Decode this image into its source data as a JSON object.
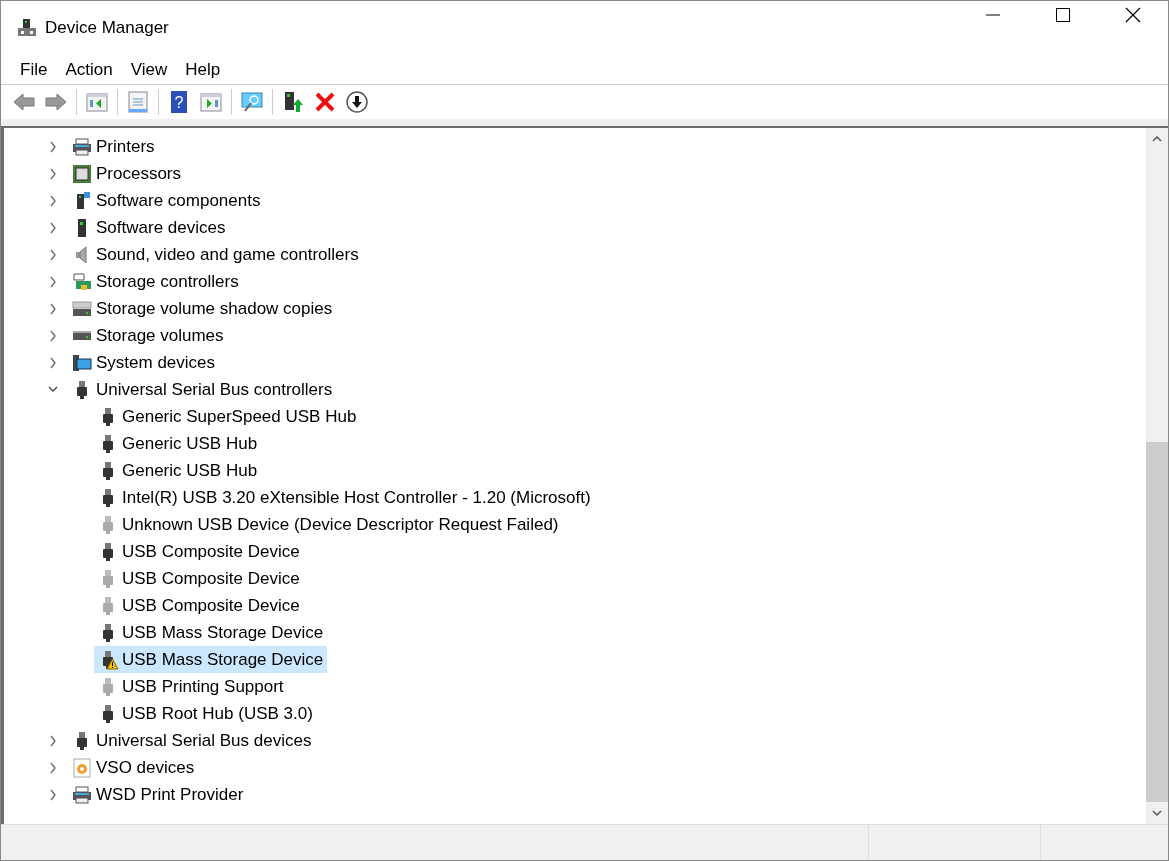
{
  "window": {
    "title": "Device Manager"
  },
  "menu": [
    "File",
    "Action",
    "View",
    "Help"
  ],
  "toolbar": {
    "help_glyph": "?"
  },
  "tree": [
    {
      "label": "Printers",
      "kind": "printer",
      "expanded": false,
      "selected": false
    },
    {
      "label": "Processors",
      "kind": "chip",
      "expanded": false,
      "selected": false
    },
    {
      "label": "Software components",
      "kind": "component",
      "expanded": false,
      "selected": false
    },
    {
      "label": "Software devices",
      "kind": "tower",
      "expanded": false,
      "selected": false
    },
    {
      "label": "Sound, video and game controllers",
      "kind": "speaker",
      "expanded": false,
      "selected": false
    },
    {
      "label": "Storage controllers",
      "kind": "controller",
      "expanded": false,
      "selected": false
    },
    {
      "label": "Storage volume shadow copies",
      "kind": "disk",
      "expanded": false,
      "selected": false
    },
    {
      "label": "Storage volumes",
      "kind": "volume",
      "expanded": false,
      "selected": false
    },
    {
      "label": "System devices",
      "kind": "monitor",
      "expanded": false,
      "selected": false
    },
    {
      "label": "Universal Serial Bus controllers",
      "kind": "usb",
      "expanded": true,
      "selected": false,
      "children": [
        {
          "label": "Generic SuperSpeed USB Hub",
          "hidden": false,
          "warning": false,
          "selected": false
        },
        {
          "label": "Generic USB Hub",
          "hidden": false,
          "warning": false,
          "selected": false
        },
        {
          "label": "Generic USB Hub",
          "hidden": false,
          "warning": false,
          "selected": false
        },
        {
          "label": "Intel(R) USB 3.20 eXtensible Host Controller - 1.20 (Microsoft)",
          "hidden": false,
          "warning": false,
          "selected": false
        },
        {
          "label": "Unknown USB Device (Device Descriptor Request Failed)",
          "hidden": true,
          "warning": false,
          "selected": false
        },
        {
          "label": "USB Composite Device",
          "hidden": false,
          "warning": false,
          "selected": false
        },
        {
          "label": "USB Composite Device",
          "hidden": true,
          "warning": false,
          "selected": false
        },
        {
          "label": "USB Composite Device",
          "hidden": true,
          "warning": false,
          "selected": false
        },
        {
          "label": "USB Mass Storage Device",
          "hidden": false,
          "warning": false,
          "selected": false
        },
        {
          "label": "USB Mass Storage Device",
          "hidden": false,
          "warning": true,
          "selected": true
        },
        {
          "label": "USB Printing Support",
          "hidden": true,
          "warning": false,
          "selected": false
        },
        {
          "label": "USB Root Hub (USB 3.0)",
          "hidden": false,
          "warning": false,
          "selected": false
        }
      ]
    },
    {
      "label": "Universal Serial Bus devices",
      "kind": "usb",
      "expanded": false,
      "selected": false
    },
    {
      "label": "VSO devices",
      "kind": "gear",
      "expanded": false,
      "selected": false
    },
    {
      "label": "WSD Print Provider",
      "kind": "printer",
      "expanded": false,
      "selected": false
    }
  ]
}
